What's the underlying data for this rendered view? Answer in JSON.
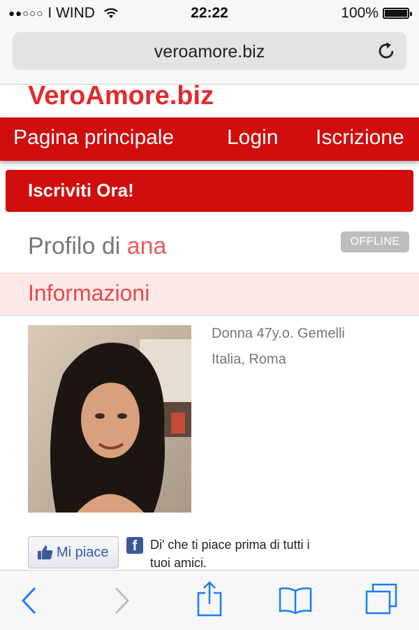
{
  "status_bar": {
    "signal": "●●○○○",
    "carrier": "I WIND",
    "time": "22:22",
    "battery": "100%"
  },
  "browser": {
    "url": "veroamore.biz"
  },
  "site": {
    "logo": "VeroAmore.biz",
    "nav": [
      "Pagina principale",
      "Login",
      "Iscrizione"
    ],
    "cta": "Iscriviti Ora!"
  },
  "profile": {
    "title_prefix": "Profilo di",
    "name": "ana",
    "status": "OFFLINE",
    "section": "Informazioni",
    "details_line1": "Donna 47y.o. Gemelli",
    "details_line2": "Italia, Roma"
  },
  "facebook": {
    "like_label": "Mi piace",
    "text": "Di' che ti piace prima di tutti i tuoi amici."
  },
  "colors": {
    "accent": "#d10d0d",
    "logo": "#e42b2b",
    "section_bg": "#fde8e8",
    "ios_blue": "#1b7cf5"
  }
}
